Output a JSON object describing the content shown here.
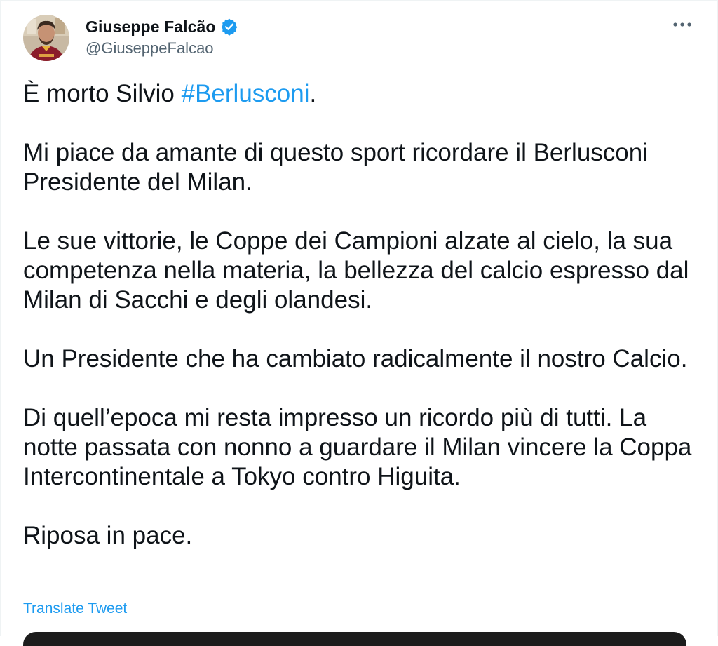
{
  "author": {
    "display_name": "Giuseppe Falcão",
    "handle": "@GiuseppeFalcao",
    "avatar_icon": "avatar-photo",
    "verified_icon": "verified-badge-icon",
    "verified_color": "#1d9bf0"
  },
  "menu": {
    "more_icon": "more-horizontal-icon"
  },
  "tweet": {
    "line1_prefix": "È morto Silvio ",
    "line1_hashtag": "#Berlusconi",
    "line1_suffix": ".",
    "paragraph2": "Mi piace da amante di questo sport ricordare il Berlusconi Presidente del Milan.",
    "paragraph3": "Le sue vittorie, le Coppe dei Campioni alzate al cielo, la sua competenza nella materia, la bellezza del calcio espresso dal Milan di Sacchi e degli olandesi.",
    "paragraph4": "Un Presidente che ha cambiato radicalmente il nostro Calcio.",
    "paragraph5": "Di quell’epoca mi resta impresso un ricordo più di tutti. La notte passata con nonno a guardare il Milan vincere la Coppa Intercontinentale a Tokyo contro Higuita.",
    "paragraph6": "Riposa in pace."
  },
  "actions": {
    "translate_label": "Translate Tweet"
  },
  "colors": {
    "link": "#1d9bf0",
    "text": "#0f1419",
    "secondary": "#536471"
  }
}
